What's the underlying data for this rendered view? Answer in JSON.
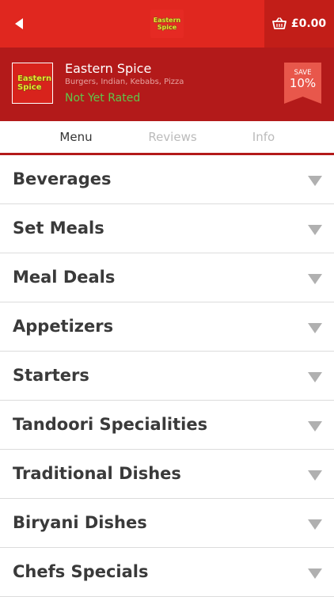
{
  "header": {
    "logo_text_line1": "Eastern",
    "logo_text_line2": "Spice",
    "cart_total": "£0.00"
  },
  "restaurant": {
    "logo_line1": "Eastern",
    "logo_line2": "Spice",
    "name": "Eastern Spice",
    "cuisines": "Burgers, Indian, Kebabs, Pizza",
    "rating": "Not Yet Rated",
    "save_label": "SAVE",
    "save_value": "10%"
  },
  "tabs": [
    {
      "label": "Menu",
      "active": true
    },
    {
      "label": "Reviews",
      "active": false
    },
    {
      "label": "Info",
      "active": false
    }
  ],
  "categories": [
    {
      "label": "Beverages"
    },
    {
      "label": "Set Meals"
    },
    {
      "label": "Meal Deals"
    },
    {
      "label": "Appetizers"
    },
    {
      "label": "Starters"
    },
    {
      "label": "Tandoori Specialities"
    },
    {
      "label": "Traditional Dishes"
    },
    {
      "label": "Biryani Dishes"
    },
    {
      "label": "Chefs Specials"
    }
  ],
  "icons": {
    "back": "back-arrow-icon",
    "cart": "basket-icon",
    "expand": "chevron-down-icon"
  },
  "colors": {
    "primary_red": "#e0271f",
    "dark_red": "#b31a1a",
    "cart_bg": "#c21e18",
    "badge_red": "#e8574b",
    "rating_green": "#5fc64a",
    "logo_yellow": "#f2e12c"
  }
}
